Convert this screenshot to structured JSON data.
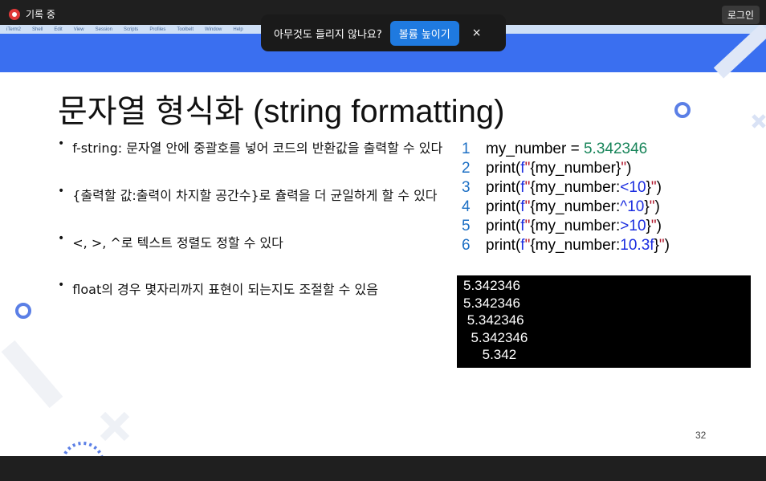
{
  "meeting": {
    "recording_label": "기록 중",
    "login_label": "로그인"
  },
  "toast": {
    "message": "아무것도 들리지 않나요?",
    "button": "볼륨 높이기",
    "close": "×"
  },
  "menubar": {
    "items": [
      "iTerm2",
      "Shell",
      "Edit",
      "View",
      "Session",
      "Scripts",
      "Profiles",
      "Toolbelt",
      "Window",
      "Help"
    ]
  },
  "slide": {
    "title": "문자열 형식화 (string formatting)",
    "bullets": [
      "f-string: 문자열 안에 중괄호를 넣어 코드의 반환값을 출력할 수 있다",
      "{출력할 값:출력이 차지할 공간수}로 츌력을 더 균일하게 할 수 있다",
      "<, >, ^로 텍스트 정렬도 정할 수 있다",
      "float의 경우 몇자리까지 표현이 되는지도 조절할 수 있음"
    ],
    "code": {
      "line_numbers": [
        "1",
        "2",
        "3",
        "4",
        "5",
        "6"
      ],
      "l1": {
        "var": "my_number = ",
        "num": "5.342346"
      },
      "l2": {
        "pre": "print(",
        "f": "f",
        "q1": "\"",
        "open": "{my_number}",
        "q2": "\"",
        "post": ")"
      },
      "l3": {
        "pre": "print(",
        "f": "f",
        "q1": "\"",
        "a": "{my_number:",
        "b": "<10",
        "c": "}",
        "q2": "\"",
        "post": ")"
      },
      "l4": {
        "pre": "print(",
        "f": "f",
        "q1": "\"",
        "a": "{my_number:",
        "b": "^10",
        "c": "}",
        "q2": "\"",
        "post": ")"
      },
      "l5": {
        "pre": "print(",
        "f": "f",
        "q1": "\"",
        "a": "{my_number:",
        "b": ">10",
        "c": "}",
        "q2": "\"",
        "post": ")"
      },
      "l6": {
        "pre": "print(",
        "f": "f",
        "q1": "\"",
        "a": "{my_number:",
        "b": "10.3f",
        "c": "}",
        "q2": "\"",
        "post": ")"
      }
    },
    "output": [
      "5.342346",
      "5.342346",
      " 5.342346",
      "  5.342346",
      "     5.342"
    ],
    "page_number": "32"
  },
  "colors": {
    "accent_blue": "#3a6ff0",
    "code_number": "#18855a",
    "code_fstring": "#1c2ee0",
    "code_quote": "#b0142a"
  }
}
